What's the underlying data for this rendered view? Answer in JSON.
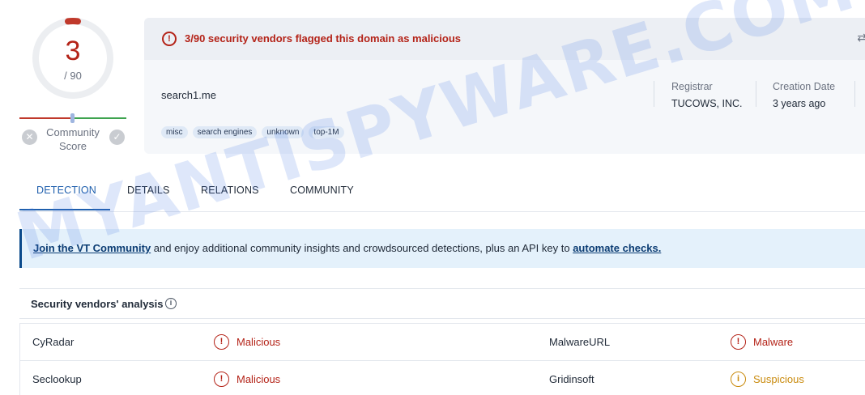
{
  "score": {
    "detections": "3",
    "total": "/ 90",
    "community_label_line1": "Community",
    "community_label_line2": "Score",
    "vote_down_icon": "close-circle-icon",
    "vote_up_icon": "check-circle-icon",
    "ring_color": "#c0392b"
  },
  "header": {
    "alert_text": "3/90 security vendors flagged this domain as malicious",
    "alert_icon": "alert-circle-icon",
    "domain": "search1.me",
    "tags": [
      "misc",
      "search engines",
      "unknown",
      "top-1M"
    ],
    "registrar_label": "Registrar",
    "registrar_value": "TUCOWS, INC.",
    "creation_label": "Creation Date",
    "creation_value": "3 years ago"
  },
  "tabs": [
    "DETECTION",
    "DETAILS",
    "RELATIONS",
    "COMMUNITY"
  ],
  "banner": {
    "link1": "Join the VT Community",
    "middle": " and enjoy additional community insights and crowdsourced detections, plus an API key to ",
    "link2": "automate checks."
  },
  "analysis": {
    "title": "Security vendors' analysis",
    "rows": [
      {
        "vendor_a": "CyRadar",
        "result_a": "Malicious",
        "vendor_b": "MalwareURL",
        "result_b": "Malware"
      },
      {
        "vendor_a": "Seclookup",
        "result_a": "Malicious",
        "vendor_b": "Gridinsoft",
        "result_b": "Suspicious"
      }
    ]
  },
  "colors": {
    "malicious": "#b42318",
    "suspicious": "#c98a0c",
    "accent": "#1f5fad"
  },
  "watermark": "MYANTISPYWARE.COM"
}
